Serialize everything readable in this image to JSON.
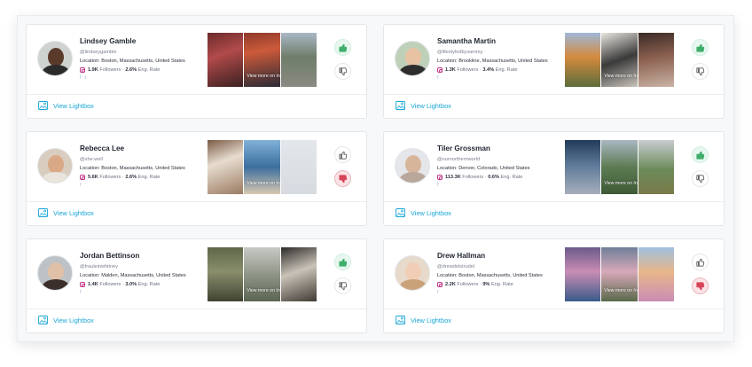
{
  "view_more_text": "View more on Instagram ↗",
  "lightbox_label": "View Lightbox",
  "followers_suffix": "Followers ·",
  "eng_suffix": "Eng. Rate",
  "colors": {
    "accent": "#19a6d6",
    "thumbs_up": "#3fae6a",
    "thumbs_down": "#d74558",
    "instagram": "#c13584"
  },
  "cards": [
    {
      "name": "Lindsey Gamble",
      "handle": "@lindseygamble",
      "location": "Location: Boston, Massachusetts, United States",
      "followers": "1.9K",
      "eng_rate": "2.6%",
      "socials": [
        "f",
        "t"
      ],
      "vote": "up",
      "avatar": {
        "bg": "#cfd3cf",
        "face": "#5a3a2a",
        "body": "#2b2b2b"
      },
      "thumbs": [
        {
          "bg": "linear-gradient(160deg,#6b2b2b 0%,#b24a4a 40%,#3a2020 100%)"
        },
        {
          "bg": "linear-gradient(170deg,#8e3a2a 0%,#cc5a3a 35%,#2a2a36 100%)"
        },
        {
          "bg": "linear-gradient(180deg,#a8b7c4 0%,#6f7d6a 45%,#8a8a82 100%)"
        }
      ]
    },
    {
      "name": "Samantha Martin",
      "handle": "@lifestyledbysammy",
      "location": "Location: Brookline, Massachusetts, United States",
      "followers": "1.3K",
      "eng_rate": "3.4%",
      "socials": [
        "f"
      ],
      "vote": "up",
      "avatar": {
        "bg": "#bfd0b8",
        "face": "#e8c3a3",
        "body": "#2e2e2e"
      },
      "thumbs": [
        {
          "bg": "linear-gradient(180deg,#9fb8d6 0%,#d48a3e 45%,#5c6d3b 100%)"
        },
        {
          "bg": "linear-gradient(160deg,#e9e6e0 0%,#3a3a3a 50%,#c8c3ba 100%)"
        },
        {
          "bg": "linear-gradient(170deg,#3a2b26 0%,#8a5f4f 45%,#c9b3a4 100%)"
        }
      ]
    },
    {
      "name": "Rebecca Lee",
      "handle": "@she.well",
      "location": "Location: Boston, Massachusetts, United States",
      "followers": "5.6K",
      "eng_rate": "2.6%",
      "socials": [
        "f"
      ],
      "vote": "down",
      "avatar": {
        "bg": "#d9cdbf",
        "face": "#d9a985",
        "body": "#e9e4dc"
      },
      "thumbs": [
        {
          "bg": "linear-gradient(160deg,#7a5a44 0%,#e7ddd0 40%,#9b7b62 100%)"
        },
        {
          "bg": "linear-gradient(180deg,#7fb1d9 0%,#3d6f9e 50%,#d8c8b0 100%)"
        },
        {
          "bg": "linear-gradient(180deg,#e3e6ea 0%,#d7dbe0 100%)"
        }
      ]
    },
    {
      "name": "Tiler Grossman",
      "handle": "@ournorthernworld",
      "location": "Location: Denver, Colorado, United States",
      "followers": "113.3K",
      "eng_rate": "0.6%",
      "socials": [
        "f"
      ],
      "vote": "up",
      "avatar": {
        "bg": "#e4e6ea",
        "face": "#d7b59a",
        "body": "#b9a79b"
      },
      "thumbs": [
        {
          "bg": "linear-gradient(180deg,#233a5a 0%,#5c7898 45%,#a6aebc 100%)"
        },
        {
          "bg": "linear-gradient(180deg,#a9b7c2 0%,#5c7b53 50%,#3f5a36 100%)"
        },
        {
          "bg": "linear-gradient(180deg,#c7ccd0 0%,#6c8a58 55%,#7b7a4a 100%)"
        }
      ]
    },
    {
      "name": "Jordan Bettinson",
      "handle": "@frauleinwhitney",
      "location": "Location: Malden, Massachusetts, United States",
      "followers": "1.4K",
      "eng_rate": "3.0%",
      "socials": [
        "f"
      ],
      "vote": "up",
      "avatar": {
        "bg": "#bcc2c6",
        "face": "#e0c1a8",
        "body": "#3a2f2b"
      },
      "thumbs": [
        {
          "bg": "linear-gradient(180deg,#5d6748 0%,#8a8e6c 45%,#3f4432 100%)"
        },
        {
          "bg": "linear-gradient(180deg,#c8c9c6 0%,#8f9688 50%,#5b6551 100%)"
        },
        {
          "bg": "linear-gradient(160deg,#2d2a28 0%,#c9c3b8 45%,#3f3a33 100%)"
        }
      ]
    },
    {
      "name": "Drew Hallman",
      "handle": "@drewdelstrudel",
      "location": "Location: Boston, Massachusetts, United States",
      "followers": "2.2K",
      "eng_rate": "9%",
      "socials": [
        "f"
      ],
      "vote": "down",
      "avatar": {
        "bg": "#e8dacb",
        "face": "#f0cdb4",
        "body": "#c9a27a"
      },
      "thumbs": [
        {
          "bg": "linear-gradient(180deg,#6b5a8a 0%,#c98db4 45%,#3a5a8a 100%)"
        },
        {
          "bg": "linear-gradient(180deg,#6f7f9a 0%,#d7a8b8 45%,#5a6a4a 100%)"
        },
        {
          "bg": "linear-gradient(180deg,#9fc1e0 0%,#e8b68a 45%,#c98db4 100%)"
        }
      ]
    }
  ]
}
